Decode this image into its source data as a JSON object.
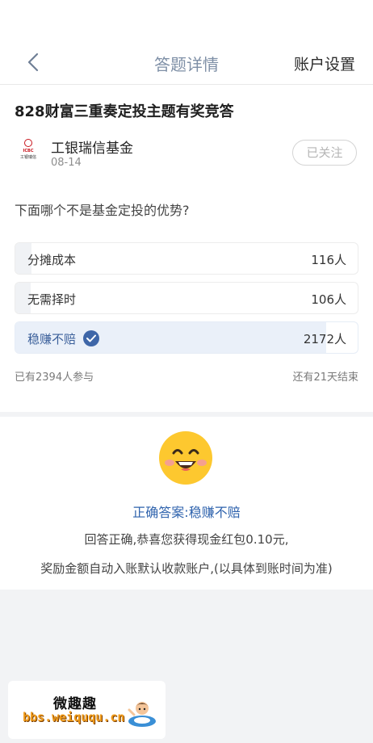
{
  "nav": {
    "title": "答题详情",
    "right_link": "账户设置",
    "back_icon": "chevron-left-icon"
  },
  "quiz": {
    "title": "828财富三重奏定投主题有奖竞答",
    "org": {
      "name": "工银瑞信基金",
      "date": "08-14",
      "logo_text_line1": "ICBC",
      "logo_text_line2": "工银瑞信",
      "follow_label": "已关注"
    },
    "question": "下面哪个不是基金定投的优势?",
    "options": [
      {
        "label": "分摊成本",
        "count": "116人",
        "share": 0.048,
        "correct": false
      },
      {
        "label": "无需择时",
        "count": "106人",
        "share": 0.044,
        "correct": false
      },
      {
        "label": "稳赚不赔",
        "count": "2172人",
        "share": 0.907,
        "correct": true
      }
    ],
    "participants": "已有2394人参与",
    "remaining": "还有21天结束"
  },
  "result": {
    "icon": "smiley-face-icon",
    "answer_text": "正确答案:稳赚不赔",
    "message_line1": "回答正确,恭喜您获得现金红包0.10元,",
    "message_line2": "奖励金额自动入账默认收款账户,(以具体到账时间为准)"
  },
  "watermark": {
    "title": "微趣趣",
    "url": "bbs.weiququ.cn"
  },
  "colors": {
    "accent": "#2f63ad",
    "nav_title": "#7e8fa6",
    "correct_fill": "#eaf0f9",
    "option_fill": "#f0f2f5",
    "brand_red": "#c8151d"
  }
}
